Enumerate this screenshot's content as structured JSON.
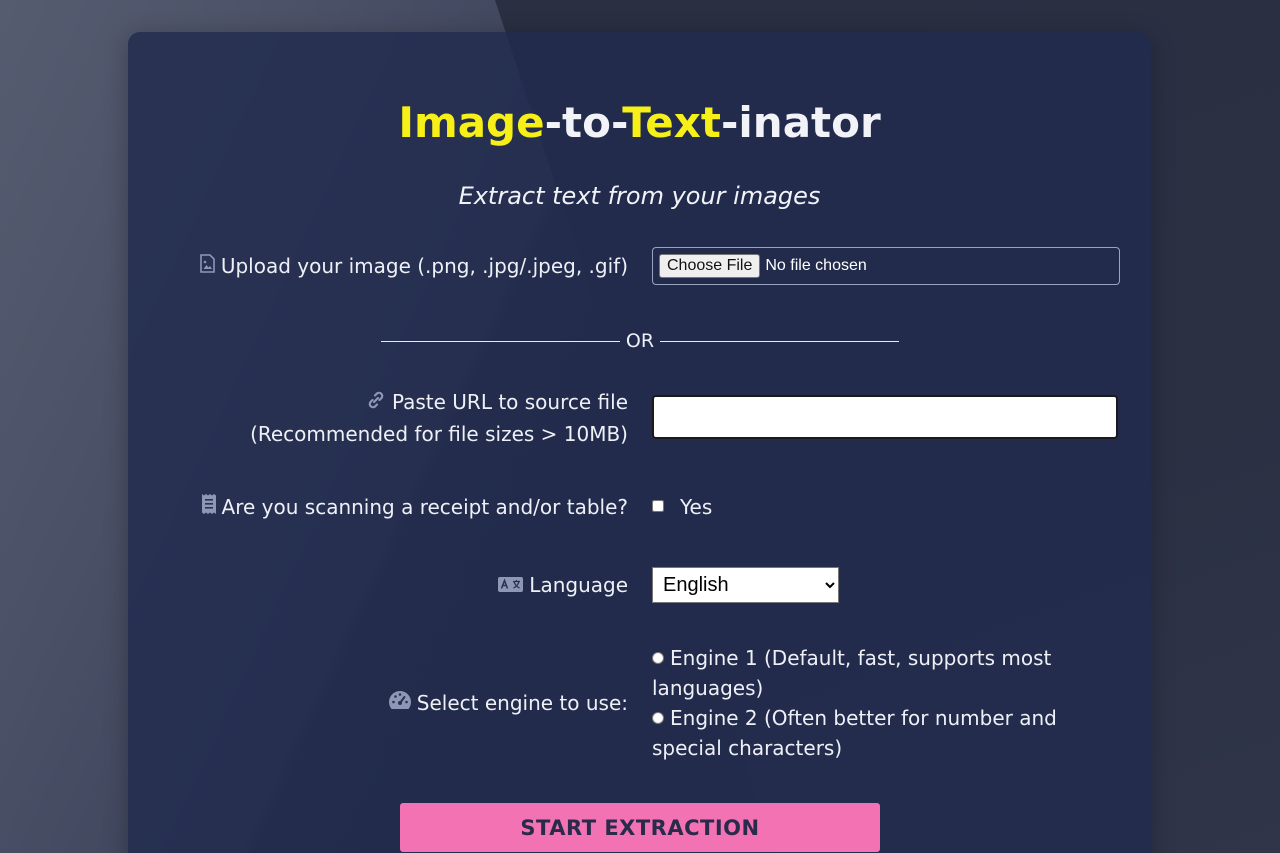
{
  "header": {
    "title_part1": "Image",
    "title_part2": "-to-",
    "title_part3": "Text",
    "title_part4": "-inator",
    "subtitle": "Extract text from your images"
  },
  "upload": {
    "label": "Upload your image (.png, .jpg/.jpeg, .gif)",
    "icon": "file-image-icon",
    "button_label": "Choose File",
    "status": "No file chosen"
  },
  "separator": {
    "text": "OR"
  },
  "url": {
    "label_line1": "Paste URL to source file",
    "label_line2": "(Recommended for file sizes > 10MB)",
    "icon": "link-icon",
    "value": ""
  },
  "receipt": {
    "label": "Are you scanning a receipt and/or table?",
    "icon": "receipt-icon",
    "option_label": "Yes"
  },
  "language": {
    "label": "Language",
    "icon": "language-icon",
    "selected": "English"
  },
  "engine": {
    "label": "Select engine to use:",
    "icon": "gauge-icon",
    "options": [
      {
        "label": "Engine 1 (Default, fast, supports most languages)"
      },
      {
        "label": "Engine 2 (Often better for number and special characters)"
      }
    ]
  },
  "actions": {
    "start_label": "START EXTRACTION"
  },
  "colors": {
    "accent_yellow": "#f6f018",
    "button_pink": "#f272b4",
    "card_bg": "#212b4e"
  }
}
